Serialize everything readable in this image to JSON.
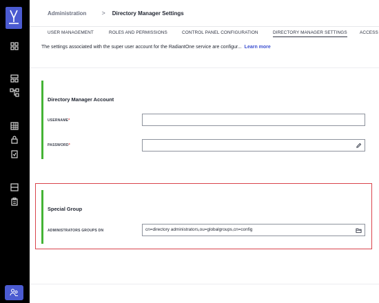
{
  "breadcrumb": {
    "root": "Administration",
    "separator": ">",
    "current": "Directory Manager Settings"
  },
  "tabs": [
    {
      "label": "USER MANAGEMENT",
      "active": false
    },
    {
      "label": "ROLES AND PERMISSIONS",
      "active": false
    },
    {
      "label": "CONTROL PANEL CONFIGURATION",
      "active": false
    },
    {
      "label": "DIRECTORY MANAGER SETTINGS",
      "active": true
    },
    {
      "label": "ACCESS",
      "active": false
    }
  ],
  "description": {
    "text": "The settings associated with the super user account for the RadiantOne service are configur...",
    "link": "Learn more"
  },
  "account": {
    "title": "Directory Manager Account",
    "username_label": "USERNAME",
    "username_value": "",
    "password_label": "PASSWORD",
    "password_value": "",
    "required_mark": "*"
  },
  "special_group": {
    "title": "Special Group",
    "admin_dn_label": "ADMINISTRATORS GROUPS DN",
    "admin_dn_value": "cn=directory administrators,ou=globalgroups,cn=config"
  },
  "colors": {
    "accent": "#4b5bd1",
    "link": "#3b4fd0",
    "section_bar": "#44b335",
    "highlight": "#d9424a"
  },
  "icons": {
    "rail": [
      "dashboard-icon",
      "directory-icon",
      "hierarchy-icon",
      "grid-icon",
      "lock-icon",
      "checklist-icon",
      "server-icon",
      "clipboard-icon",
      "user-group-icon"
    ],
    "password_edit": "pencil-icon",
    "dn_browse": "folder-icon"
  }
}
